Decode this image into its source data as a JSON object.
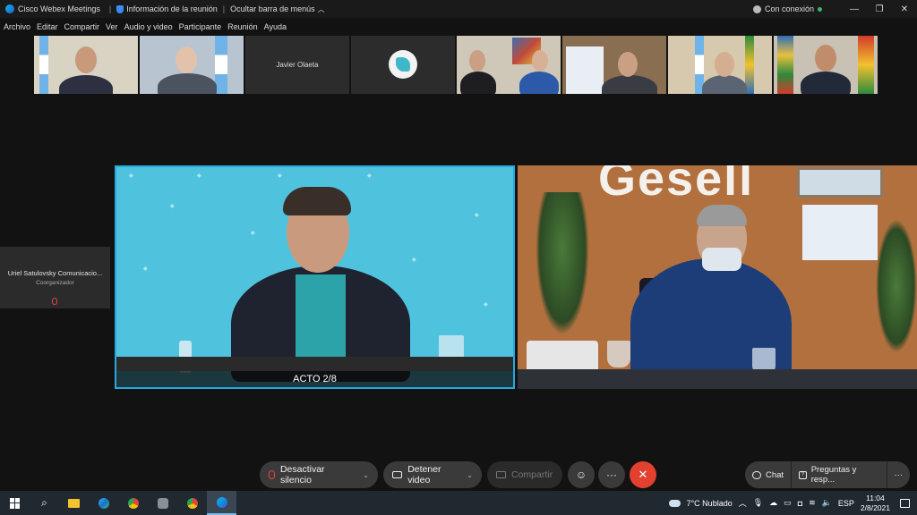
{
  "window": {
    "app_title": "Cisco Webex Meetings",
    "meeting_info": "Información de la reunión",
    "hide_menu": "Ocultar barra de menús",
    "connection": "Con conexión",
    "minimize": "—",
    "restore": "❐",
    "close": "✕"
  },
  "menu": [
    "Archivo",
    "Editar",
    "Compartir",
    "Ver",
    "Audio y video",
    "Participante",
    "Reunión",
    "Ayuda"
  ],
  "thumbnails": {
    "javier_name": "Javier Olaeta"
  },
  "side_participant": {
    "name": "Uriel Satulovsky Comunicacio...",
    "role": "Coorganizador"
  },
  "main_video": {
    "caption": "ACTO 2/8"
  },
  "controls": {
    "mute_label": "Desactivar silencio",
    "video_label": "Detener video",
    "share_label": "Compartir",
    "more_label": "···",
    "end_icon": "✕",
    "chat_label": "Chat",
    "qa_label": "Preguntas y resp...",
    "panel_more": "···"
  },
  "taskbar": {
    "weather": "7°C  Nublado",
    "lang": "ESP",
    "time": "11:04",
    "date": "2/8/2021"
  },
  "colors": {
    "accent_blue": "#2aa7e0",
    "end_red": "#e2412f",
    "connected_green": "#3cb371"
  }
}
